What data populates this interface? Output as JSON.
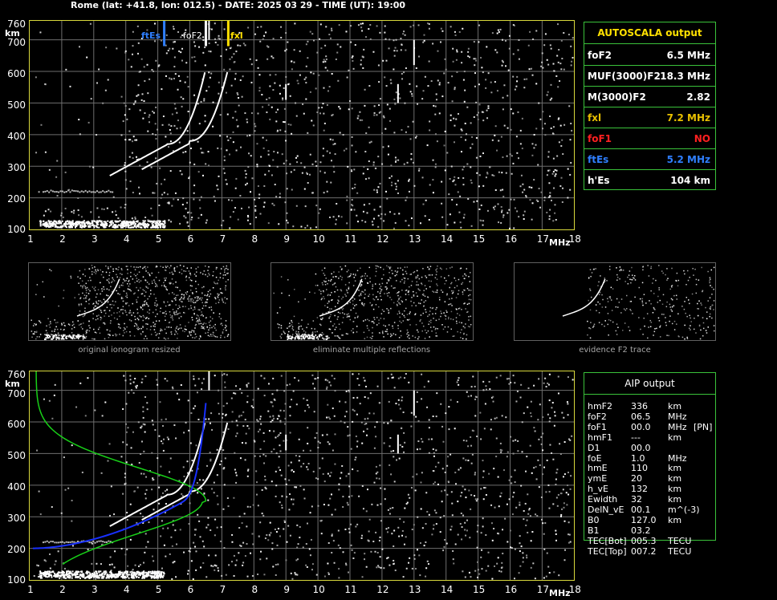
{
  "header": {
    "title": "Rome (lat: +41.8, lon: 012.5) - DATE: 2025 03 29 - TIME (UT): 19:00"
  },
  "axes": {
    "y_ticks": [
      "760",
      "700",
      "600",
      "500",
      "400",
      "300",
      "200",
      "100"
    ],
    "y_unit": "km",
    "x_ticks": [
      "1",
      "2",
      "3",
      "4",
      "5",
      "6",
      "7",
      "8",
      "9",
      "10",
      "11",
      "12",
      "13",
      "14",
      "15",
      "16",
      "17",
      "18"
    ],
    "x_unit": "MHz"
  },
  "markers": {
    "ftes": "ftEs",
    "fof2": "foF2",
    "fxl": "fxl"
  },
  "autoscala": {
    "title": "AUTOSCALA output",
    "rows": [
      {
        "key": "foF2",
        "value": "6.5 MHz",
        "color": "#ffffff"
      },
      {
        "key": "MUF(3000)F2",
        "value": "18.3 MHz",
        "color": "#ffffff"
      },
      {
        "key": "M(3000)F2",
        "value": "2.82",
        "color": "#ffffff"
      },
      {
        "key": "fxl",
        "value": "7.2 MHz",
        "color": "#e8c000"
      },
      {
        "key": "foF1",
        "value": "NO",
        "color": "#ff2020"
      },
      {
        "key": "ftEs",
        "value": "5.2 MHz",
        "color": "#2f7fff"
      },
      {
        "key": "h'Es",
        "value": "104    km",
        "color": "#ffffff"
      }
    ]
  },
  "thumbnails": [
    {
      "caption": "original ionogram resized"
    },
    {
      "caption": "eliminate multiple reflections"
    },
    {
      "caption": "evidence F2 trace"
    }
  ],
  "aip": {
    "title": "AIP output",
    "lines": [
      {
        "key": "hmF2",
        "value": "336",
        "unit": "km",
        "extra": ""
      },
      {
        "key": "foF2",
        "value": "06.5",
        "unit": "MHz",
        "extra": ""
      },
      {
        "key": "foF1",
        "value": "00.0",
        "unit": "MHz",
        "extra": "[PN]"
      },
      {
        "key": "hmF1",
        "value": "---",
        "unit": "km",
        "extra": ""
      },
      {
        "key": "D1",
        "value": "00.0",
        "unit": "",
        "extra": ""
      },
      {
        "key": "foE",
        "value": "1.0",
        "unit": "MHz",
        "extra": ""
      },
      {
        "key": "hmE",
        "value": "110",
        "unit": "km",
        "extra": ""
      },
      {
        "key": "ymE",
        "value": "20",
        "unit": "km",
        "extra": ""
      },
      {
        "key": "h_vE",
        "value": "132",
        "unit": "km",
        "extra": ""
      },
      {
        "key": "Ewidth",
        "value": "32",
        "unit": "km",
        "extra": ""
      },
      {
        "key": "DelN_vE",
        "value": "00.1",
        "unit": "m^(-3)",
        "extra": ""
      },
      {
        "key": "B0",
        "value": "127.0",
        "unit": "km",
        "extra": ""
      },
      {
        "key": "B1",
        "value": "03.2",
        "unit": "",
        "extra": ""
      },
      {
        "key": "TEC[Bot]",
        "value": "005.3",
        "unit": "TECU",
        "extra": ""
      },
      {
        "key": "TEC[Top]",
        "value": "007.2",
        "unit": "TECU",
        "extra": ""
      }
    ]
  },
  "colors": {
    "frame": "#d8d83c",
    "grid": "#6e6e6e",
    "panel_border": "#3ac23a",
    "ftes": "#2f7fff",
    "fof2": "#ffffff",
    "fxl": "#ffe000",
    "profile_green": "#18d018",
    "profile_blue": "#1830ff"
  }
}
